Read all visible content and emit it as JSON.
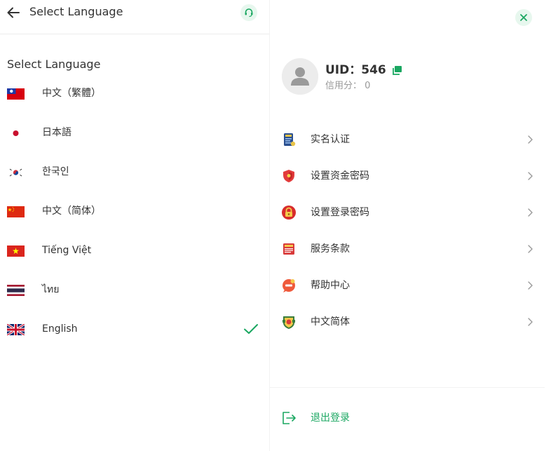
{
  "header": {
    "title": "Select Language"
  },
  "language_section": {
    "title": "Select Language",
    "selected_index": 6,
    "items": [
      {
        "label": "中文（繁體）",
        "flag": "taiwan-flag"
      },
      {
        "label": "日本語",
        "flag": "japan-flag"
      },
      {
        "label": "한국인",
        "flag": "korea-flag"
      },
      {
        "label": "中文（简体）",
        "flag": "china-flag"
      },
      {
        "label": "Tiếng Việt",
        "flag": "vietnam-flag"
      },
      {
        "label": "ไทย",
        "flag": "thailand-flag"
      },
      {
        "label": "English",
        "flag": "uk-flag"
      }
    ]
  },
  "profile": {
    "uid_label": "UID：",
    "uid_value": "546",
    "credit_label": "信用分：",
    "credit_value": "0"
  },
  "menu": {
    "items": [
      {
        "label": "实名认证",
        "icon": "id-card-icon"
      },
      {
        "label": "设置资金密码",
        "icon": "shield-icon"
      },
      {
        "label": "设置登录密码",
        "icon": "lock-icon"
      },
      {
        "label": "服务条款",
        "icon": "rules-book-icon"
      },
      {
        "label": "帮助中心",
        "icon": "help-bubble-icon"
      },
      {
        "label": "中文简体",
        "icon": "language-badge-icon"
      }
    ]
  },
  "logout": {
    "label": "退出登录"
  },
  "colors": {
    "accent": "#1aa761",
    "accent_bg": "#e7f7ee",
    "text": "#333333",
    "muted": "#999999"
  }
}
